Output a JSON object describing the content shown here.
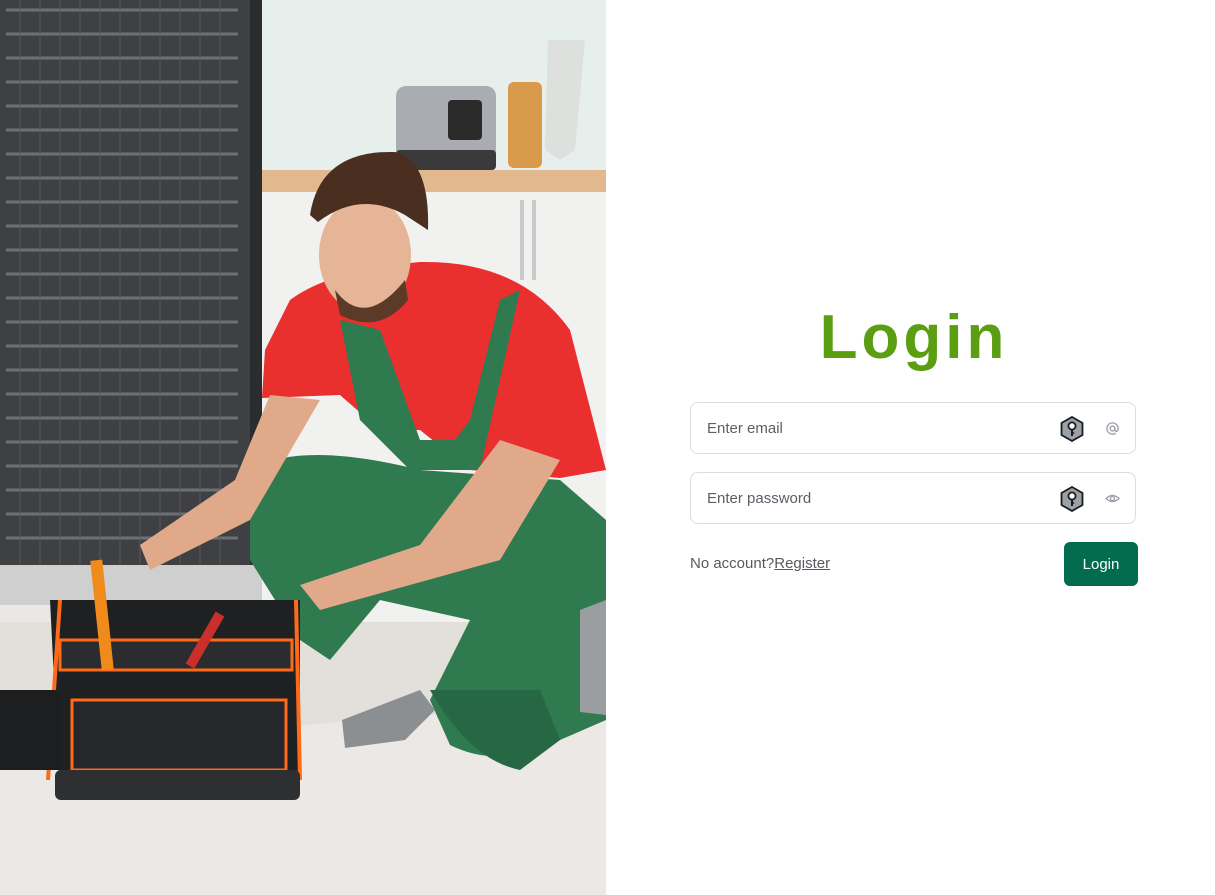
{
  "colors": {
    "title_accent": "#5b9e12",
    "button_bg": "#036c4f",
    "button_text": "#ffffff",
    "border": "#d9dde2"
  },
  "hero": {
    "image_semantic": "technician-repairing-refrigerator-photo"
  },
  "form": {
    "title": "Login",
    "email": {
      "placeholder": "Enter email",
      "value": "",
      "badge_icon": "key-shield-icon",
      "trailing_icon": "at-sign-icon"
    },
    "password": {
      "placeholder": "Enter password",
      "value": "",
      "badge_icon": "key-shield-icon",
      "trailing_icon": "eye-icon"
    },
    "no_account_text": "No account?",
    "register_label": "Register",
    "login_label": "Login"
  }
}
